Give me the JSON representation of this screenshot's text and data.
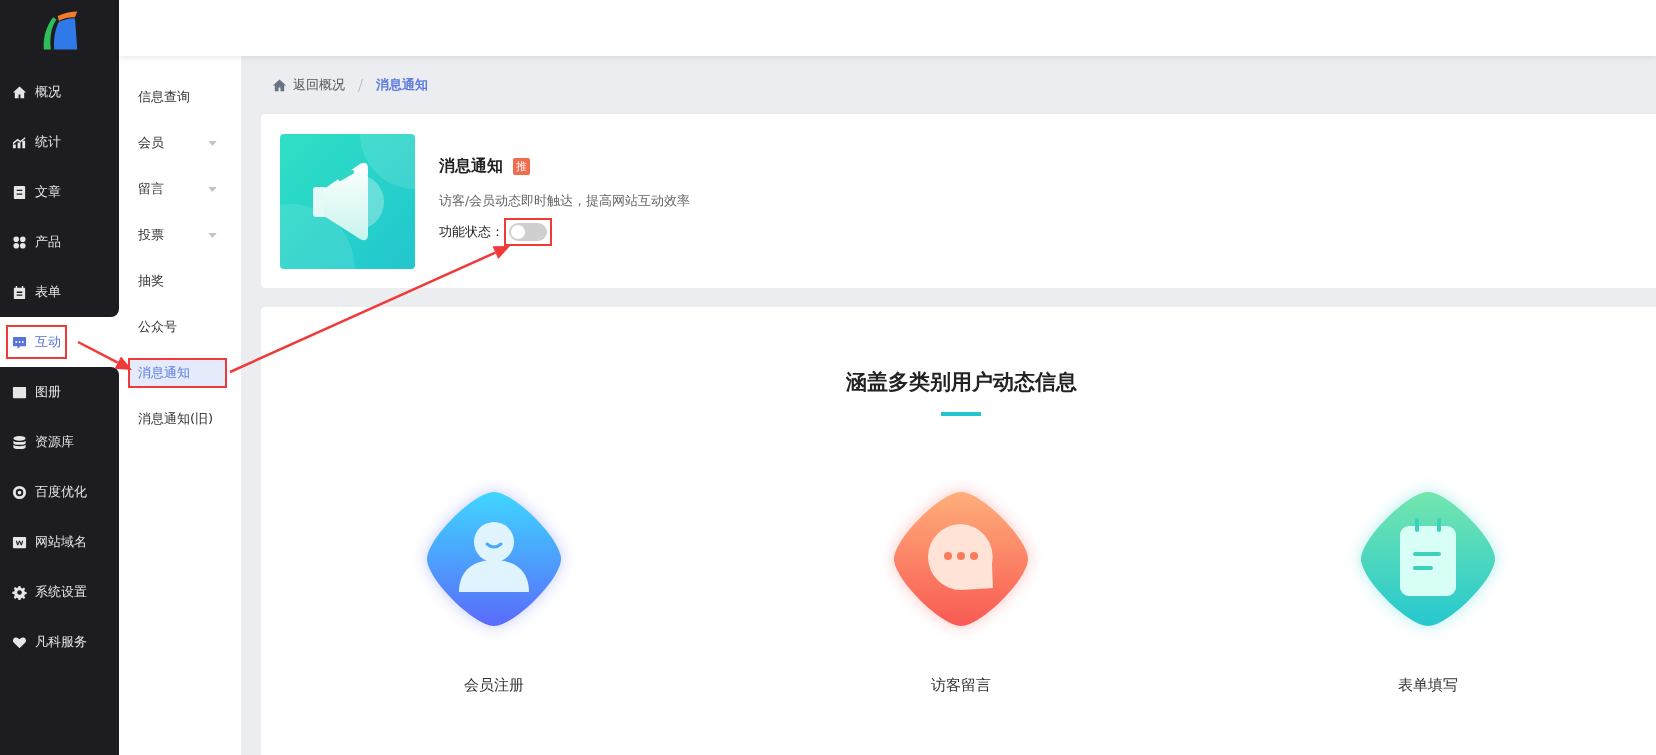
{
  "sidebar": {
    "items": [
      {
        "label": "概况",
        "selected": false,
        "highlighted": false
      },
      {
        "label": "统计",
        "selected": false,
        "highlighted": false
      },
      {
        "label": "文章",
        "selected": false,
        "highlighted": false
      },
      {
        "label": "产品",
        "selected": false,
        "highlighted": false
      },
      {
        "label": "表单",
        "selected": false,
        "highlighted": false
      },
      {
        "label": "互动",
        "selected": true,
        "highlighted": true
      },
      {
        "label": "图册",
        "selected": false,
        "highlighted": false
      },
      {
        "label": "资源库",
        "selected": false,
        "highlighted": false
      },
      {
        "label": "百度优化",
        "selected": false,
        "highlighted": false
      },
      {
        "label": "网站域名",
        "selected": false,
        "highlighted": false
      },
      {
        "label": "系统设置",
        "selected": false,
        "highlighted": false
      },
      {
        "label": "凡科服务",
        "selected": false,
        "highlighted": false
      }
    ]
  },
  "submenu": {
    "items": [
      {
        "label": "信息查询",
        "selected": false,
        "has_dropdown": false,
        "highlighted": false
      },
      {
        "label": "会员",
        "selected": false,
        "has_dropdown": true,
        "highlighted": false
      },
      {
        "label": "留言",
        "selected": false,
        "has_dropdown": true,
        "highlighted": false
      },
      {
        "label": "投票",
        "selected": false,
        "has_dropdown": true,
        "highlighted": false
      },
      {
        "label": "抽奖",
        "selected": false,
        "has_dropdown": false,
        "highlighted": false
      },
      {
        "label": "公众号",
        "selected": false,
        "has_dropdown": false,
        "highlighted": false
      },
      {
        "label": "消息通知",
        "selected": true,
        "has_dropdown": false,
        "highlighted": true
      },
      {
        "label": "消息通知(旧)",
        "selected": false,
        "has_dropdown": false,
        "highlighted": false
      }
    ]
  },
  "breadcrumb": {
    "back": "返回概况",
    "current": "消息通知"
  },
  "feature": {
    "title": "消息通知",
    "badge": "推",
    "description": "访客/会员动态即时触达，提高网站互动效率",
    "status_label": "功能状态：",
    "toggle": {
      "on": false,
      "annotated": true
    }
  },
  "overview": {
    "title": "涵盖多类别用户动态信息",
    "items": [
      {
        "kind": "member",
        "label": "会员注册"
      },
      {
        "kind": "message",
        "label": "访客留言"
      },
      {
        "kind": "form",
        "label": "表单填写"
      }
    ]
  }
}
